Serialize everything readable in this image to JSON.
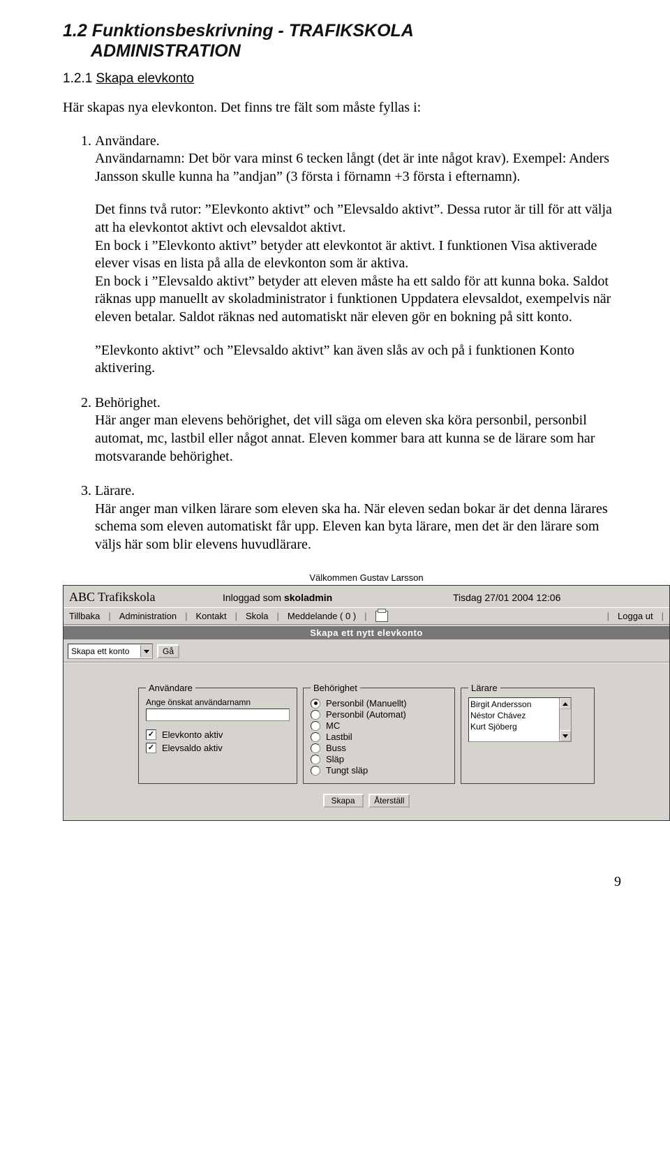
{
  "heading": {
    "number": "1.2",
    "title_line1": "Funktionsbeskrivning - TRAFIKSKOLA",
    "title_line2": "ADMINISTRATION"
  },
  "subheading": {
    "number": "1.2.1",
    "title": "Skapa elevkonto"
  },
  "intro": "Här skapas nya elevkonton. Det finns tre fält som måste fyllas i:",
  "items": [
    {
      "title": "Användare.",
      "paras": [
        "Användarnamn: Det bör vara minst 6 tecken långt (det är inte något krav). Exempel: Anders Jansson skulle kunna ha ”andjan” (3 första i förnamn +3 första i efternamn).",
        "Det finns två rutor: ”Elevkonto aktivt” och ”Elevsaldo aktivt”. Dessa rutor är till för att välja att ha elevkontot aktivt och elevsaldot aktivt.\nEn bock i ”Elevkonto aktivt” betyder att elevkontot är aktivt. I funktionen Visa aktiverade elever visas en lista på alla de elevkonton som är aktiva.\nEn bock i ”Elevsaldo aktivt” betyder att eleven måste ha ett saldo för att kunna boka. Saldot räknas upp manuellt av skoladministrator i funktionen Uppdatera elevsaldot, exempelvis när eleven betalar. Saldot räknas ned automatiskt när eleven gör en bokning på sitt konto.",
        "”Elevkonto aktivt” och ”Elevsaldo aktivt” kan även slås av och på i funktionen Konto aktivering."
      ]
    },
    {
      "title": "Behörighet.",
      "paras": [
        "Här anger man elevens behörighet, det vill säga om eleven ska köra personbil, personbil automat, mc, lastbil eller något annat. Eleven kommer bara att kunna se de lärare som har motsvarande behörighet."
      ]
    },
    {
      "title": "Lärare.",
      "paras": [
        "Här anger man vilken lärare som eleven ska ha. När eleven sedan bokar är det denna lärares schema som eleven automatiskt får upp. Eleven kan byta lärare, men det är den lärare som väljs här som blir elevens huvudlärare."
      ]
    }
  ],
  "screenshot": {
    "welcome": "Välkommen Gustav Larsson",
    "school": "ABC Trafikskola",
    "logged_label": "Inloggad som ",
    "logged_role": "skoladmin",
    "date": "Tisdag 27/01 2004 12:06",
    "menu": {
      "back": "Tillbaka",
      "admin": "Administration",
      "contact": "Kontakt",
      "school": "Skola",
      "msg": "Meddelande ( 0 )",
      "logout": "Logga ut"
    },
    "panel_title": "Skapa ett nytt elevkonto",
    "combo_value": "Skapa ett konto",
    "go_button": "Gå",
    "groups": {
      "user": {
        "legend": "Användare",
        "placeholder": "Ange önskat användarnamn",
        "chk1": "Elevkonto aktiv",
        "chk2": "Elevsaldo aktiv"
      },
      "beh": {
        "legend": "Behörighet",
        "opts": [
          "Personbil (Manuellt)",
          "Personbil (Automat)",
          "MC",
          "Lastbil",
          "Buss",
          "Släp",
          "Tungt släp"
        ],
        "selected": 0
      },
      "lar": {
        "legend": "Lärare",
        "items": [
          "Birgit Andersson",
          "Néstor Chávez",
          "Kurt Sjöberg"
        ]
      }
    },
    "buttons": {
      "create": "Skapa",
      "reset": "Återställ"
    }
  },
  "page_number": "9"
}
